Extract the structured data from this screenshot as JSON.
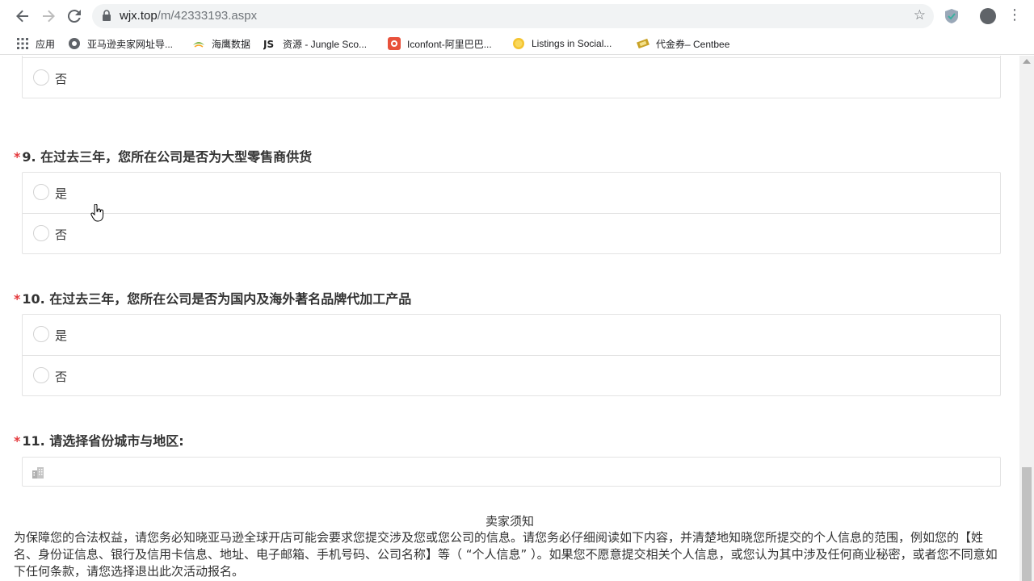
{
  "browser": {
    "url_host": "wjx.top",
    "url_path": "/m/42333193.aspx",
    "bookmarks": [
      {
        "label": "应用",
        "icon": "apps-grid-icon"
      },
      {
        "label": "亚马逊卖家网址导...",
        "icon": "globe-icon"
      },
      {
        "label": "海鹰数据",
        "icon": "eagle-icon"
      },
      {
        "label": "资源 - Jungle Sco...",
        "icon": "js-icon"
      },
      {
        "label": "Iconfont-阿里巴巴...",
        "icon": "iconfont-icon"
      },
      {
        "label": "Listings in Social...",
        "icon": "coin-icon"
      },
      {
        "label": "代金券– Centbee",
        "icon": "voucher-icon"
      }
    ]
  },
  "form": {
    "prev_option": "否",
    "q9": {
      "number": "9.",
      "title": "在过去三年，您所在公司是否为大型零售商供货",
      "required": "*",
      "options": [
        "是",
        "否"
      ]
    },
    "q10": {
      "number": "10.",
      "title": "在过去三年，您所在公司是否为国内及海外著名品牌代加工产品",
      "required": "*",
      "options": [
        "是",
        "否"
      ]
    },
    "q11": {
      "number": "11.",
      "title": "请选择省份城市与地区:",
      "required": "*"
    }
  },
  "notice": {
    "title": "卖家须知",
    "body": "为保障您的合法权益，请您务必知晓亚马逊全球开店可能会要求您提交涉及您或您公司的信息。请您务必仔细阅读如下内容，并清楚地知晓您所提交的个人信息的范围，例如您的【姓名、身份证信息、银行及信用卡信息、地址、电子邮箱、手机号码、公司名称】等（ “个人信息” ）。如果您不愿意提交相关个人信息，或您认为其中涉及任何商业秘密，或者您不同意如下任何条款，请您选择退出此次活动报名。"
  },
  "colors": {
    "required": "#e4393c",
    "border": "#e3e3e3",
    "text": "#333333"
  }
}
